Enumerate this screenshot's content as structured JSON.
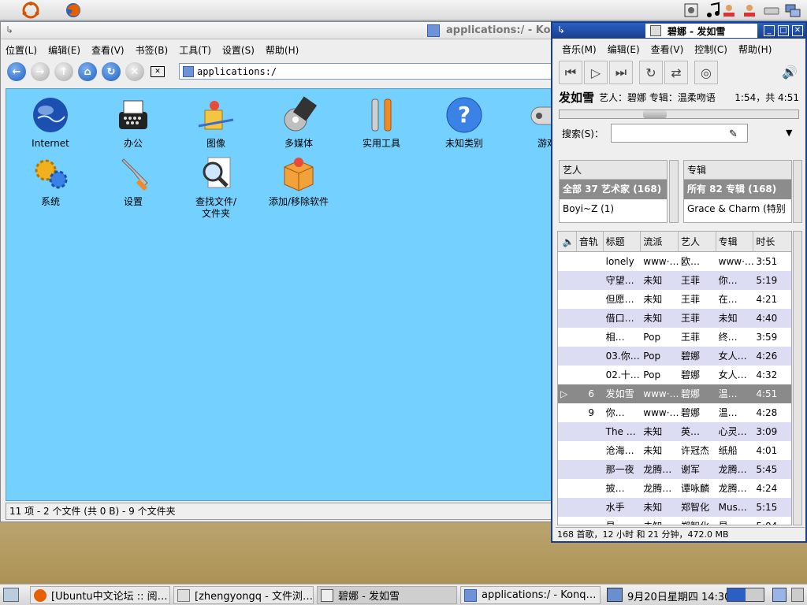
{
  "konqueror": {
    "title": "applications:/ - Kon",
    "menu": [
      "位置(L)",
      "编辑(E)",
      "查看(V)",
      "书签(B)",
      "工具(T)",
      "设置(S)",
      "帮助(H)"
    ],
    "address": "applications:/",
    "items": [
      {
        "label": "Internet",
        "icon": "globe-icon"
      },
      {
        "label": "办公",
        "icon": "typewriter-icon"
      },
      {
        "label": "图像",
        "icon": "paint-icon"
      },
      {
        "label": "多媒体",
        "icon": "multimedia-icon"
      },
      {
        "label": "实用工具",
        "icon": "tools-icon"
      },
      {
        "label": "未知类别",
        "icon": "help-icon"
      },
      {
        "label": "游戏",
        "icon": "gamepad-icon"
      },
      {
        "label": "系统",
        "icon": "gears-icon"
      },
      {
        "label": "设置",
        "icon": "wrench-icon"
      },
      {
        "label": "查找文件/\n文件夹",
        "icon": "find-icon"
      },
      {
        "label": "添加/移除软件",
        "icon": "package-icon"
      }
    ],
    "status": "11 项 - 2 个文件 (共 0 B) - 9 个文件夹"
  },
  "amarok": {
    "title": "碧娜 - 发如雪",
    "menu": [
      "音乐(M)",
      "编辑(E)",
      "查看(V)",
      "控制(C)",
      "帮助(H)"
    ],
    "now_song": "发如雪",
    "now_meta": "艺人：碧娜 专辑：温柔吻语",
    "now_time": "1:54，共 4:51",
    "progress": 0.39,
    "search_label": "搜索(S)：",
    "search_value": "",
    "artist_browser": {
      "header": "艺人",
      "rows": [
        "全部 37 艺术家 (168)",
        "Boyi~Z (1)"
      ]
    },
    "album_browser": {
      "header": "专辑",
      "rows": [
        "所有 82 专辑 (168)",
        "Grace & Charm (特别"
      ]
    },
    "playlist_columns": [
      "音轨",
      "标题",
      "流派",
      "艺人",
      "专辑",
      "时长"
    ],
    "playlist": [
      {
        "track": "",
        "title": "lonely",
        "genre": "www·…",
        "artist": "欧…",
        "album": "www·…",
        "length": "3:51"
      },
      {
        "track": "",
        "title": "守望…",
        "genre": "未知",
        "artist": "王菲",
        "album": "你…",
        "length": "5:19"
      },
      {
        "track": "",
        "title": "但愿…",
        "genre": "未知",
        "artist": "王菲",
        "album": "在…",
        "length": "4:21"
      },
      {
        "track": "",
        "title": "借口…",
        "genre": "未知",
        "artist": "王菲",
        "album": "未知",
        "length": "4:40"
      },
      {
        "track": "",
        "title": "相…",
        "genre": "Pop",
        "artist": "王菲",
        "album": "终…",
        "length": "3:59"
      },
      {
        "track": "",
        "title": "03.你…",
        "genre": "Pop",
        "artist": "碧娜",
        "album": "女人…",
        "length": "4:26"
      },
      {
        "track": "",
        "title": "02.十…",
        "genre": "Pop",
        "artist": "碧娜",
        "album": "女人…",
        "length": "4:32"
      },
      {
        "track": "6",
        "title": "发如雪",
        "genre": "www·…",
        "artist": "碧娜",
        "album": "温…",
        "length": "4:51"
      },
      {
        "track": "9",
        "title": "你…",
        "genre": "www·…",
        "artist": "碧娜",
        "album": "温…",
        "length": "4:28"
      },
      {
        "track": "",
        "title": "The …",
        "genre": "未知",
        "artist": "英…",
        "album": "心灵…",
        "length": "3:09"
      },
      {
        "track": "",
        "title": "沧海…",
        "genre": "未知",
        "artist": "许冠杰",
        "album": "纸船",
        "length": "4:01"
      },
      {
        "track": "",
        "title": "那一夜",
        "genre": "龙腾…",
        "artist": "谢军",
        "album": "龙腾…",
        "length": "5:45"
      },
      {
        "track": "",
        "title": "披…",
        "genre": "龙腾…",
        "artist": "谭咏麟",
        "album": "龙腾…",
        "length": "4:24"
      },
      {
        "track": "",
        "title": "水手",
        "genre": "未知",
        "artist": "郑智化",
        "album": "Mus…",
        "length": "5:15"
      },
      {
        "track": "",
        "title": "星…",
        "genre": "未知",
        "artist": "郑智化",
        "album": "星…",
        "length": "5:04"
      }
    ],
    "status": "168 首歌，12 小时 和 21 分钟，472.0 MB"
  },
  "taskbar": {
    "tasks": [
      "[Ubuntu中文论坛 :: 阅…",
      "[zhengyongq - 文件浏…",
      "碧娜 - 发如雪",
      "applications:/ - Konq…"
    ],
    "clock": "9月20日星期四 14:30"
  },
  "colors": {
    "desktop_view": "#74d0ff",
    "title_active": "#1a3f8a"
  }
}
